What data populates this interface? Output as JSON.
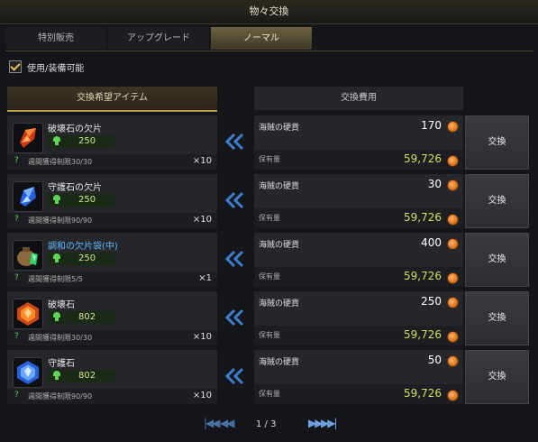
{
  "title": "物々交換",
  "tabs": [
    {
      "label": "特別販売",
      "active": false
    },
    {
      "label": "アップグレード",
      "active": false
    },
    {
      "label": "ノーマル",
      "active": true
    }
  ],
  "filter": {
    "label": "使用/装備可能",
    "checked": true
  },
  "headers": {
    "left": "交換希望アイテム",
    "right": "交換費用"
  },
  "exchange_button_label": "交換",
  "rows": [
    {
      "name": "破壊石の欠片",
      "name_color": "white",
      "icon": "red-shard-icon",
      "price": "250",
      "limit": "週間獲得制限30/30",
      "qty": "×10",
      "cost_name": "海賊の硬貨",
      "cost": "170",
      "owned_label": "保有量",
      "owned": "59,726"
    },
    {
      "name": "守護石の欠片",
      "name_color": "white",
      "icon": "blue-shard-icon",
      "price": "250",
      "limit": "週間獲得制限90/90",
      "qty": "×10",
      "cost_name": "海賊の硬貨",
      "cost": "30",
      "owned_label": "保有量",
      "owned": "59,726"
    },
    {
      "name": "調和の欠片袋(中)",
      "name_color": "blue",
      "icon": "pouch-icon",
      "price": "250",
      "limit": "週間獲得制限5/5",
      "qty": "×1",
      "cost_name": "海賊の硬貨",
      "cost": "400",
      "owned_label": "保有量",
      "owned": "59,726"
    },
    {
      "name": "破壊石",
      "name_color": "white",
      "icon": "red-stone-icon",
      "price": "802",
      "limit": "週間獲得制限30/30",
      "qty": "×10",
      "cost_name": "海賊の硬貨",
      "cost": "250",
      "owned_label": "保有量",
      "owned": "59,726"
    },
    {
      "name": "守護石",
      "name_color": "white",
      "icon": "blue-stone-icon",
      "price": "802",
      "limit": "週間獲得制限90/90",
      "qty": "×10",
      "cost_name": "海賊の硬貨",
      "cost": "50",
      "owned_label": "保有量",
      "owned": "59,726"
    }
  ],
  "pagination": {
    "text": "1 / 3",
    "first": "|◀◀",
    "prev": "◀◀",
    "next": "▶▶",
    "last": "▶▶|"
  },
  "colors": {
    "accent": "#b89b4a",
    "owned": "#cfe05a",
    "coin": "#d8741f",
    "arrow": "#3f7fd0"
  }
}
